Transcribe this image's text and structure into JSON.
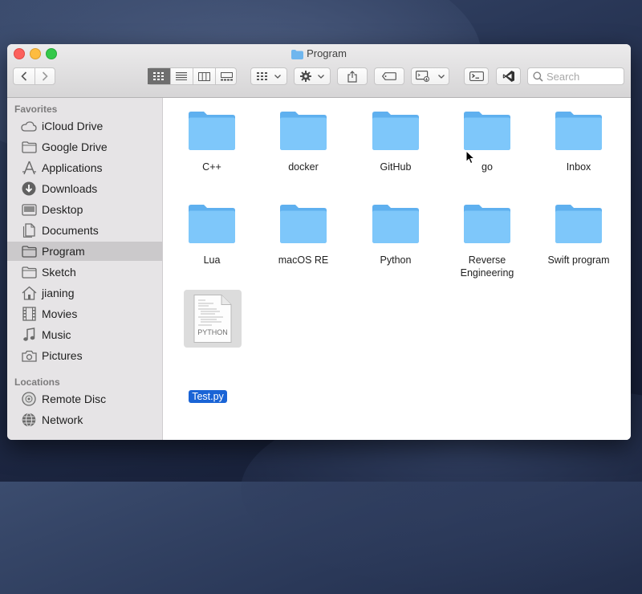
{
  "window": {
    "title": "Program"
  },
  "toolbar": {
    "search_placeholder": "Search"
  },
  "sidebar": {
    "favorites_header": "Favorites",
    "favorites": [
      {
        "label": "iCloud Drive",
        "icon": "cloud-icon"
      },
      {
        "label": "Google Drive",
        "icon": "folder-icon"
      },
      {
        "label": "Applications",
        "icon": "applications-icon"
      },
      {
        "label": "Downloads",
        "icon": "downloads-icon"
      },
      {
        "label": "Desktop",
        "icon": "desktop-icon"
      },
      {
        "label": "Documents",
        "icon": "documents-icon"
      },
      {
        "label": "Program",
        "icon": "folder-icon",
        "selected": true
      },
      {
        "label": "Sketch",
        "icon": "folder-icon"
      },
      {
        "label": "jianing",
        "icon": "home-icon"
      },
      {
        "label": "Movies",
        "icon": "movies-icon"
      },
      {
        "label": "Music",
        "icon": "music-icon"
      },
      {
        "label": "Pictures",
        "icon": "camera-icon"
      }
    ],
    "locations_header": "Locations",
    "locations": [
      {
        "label": "Remote Disc",
        "icon": "disc-icon"
      },
      {
        "label": "Network",
        "icon": "network-icon"
      }
    ]
  },
  "files": {
    "folders": [
      "C++",
      "docker",
      "GitHub",
      "go",
      "Inbox",
      "Lua",
      "macOS RE",
      "Python",
      "Reverse Engineering",
      "Swift program"
    ],
    "document": {
      "name": "Test.py",
      "type_label": "PYTHON"
    }
  },
  "colors": {
    "folder": "#74c3f7",
    "selection": "#1a64d6",
    "sidebar_bg": "#e6e4e6"
  }
}
